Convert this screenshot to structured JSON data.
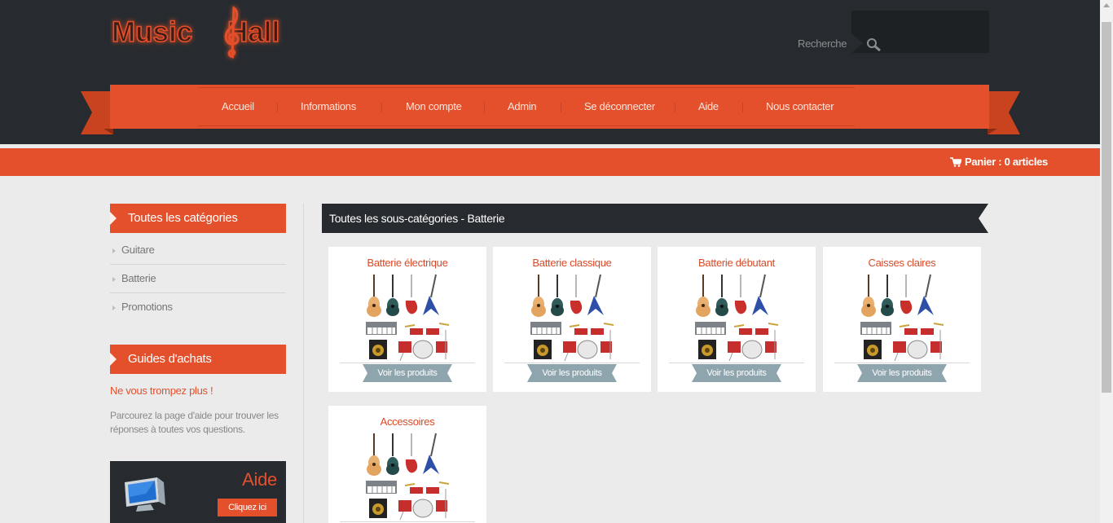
{
  "header": {
    "logo_text_left": "Music",
    "logo_text_right": "Hall",
    "search_label": "Recherche",
    "search_placeholder": ""
  },
  "nav": {
    "items": [
      {
        "label": "Accueil"
      },
      {
        "label": "Informations"
      },
      {
        "label": "Mon compte"
      },
      {
        "label": "Admin"
      },
      {
        "label": "Se déconnecter"
      },
      {
        "label": "Aide"
      },
      {
        "label": "Nous contacter"
      }
    ]
  },
  "cart": {
    "label": "Panier : 0 articles",
    "icon": "cart-icon"
  },
  "sidebar": {
    "categories_title": "Toutes les catégories",
    "categories": [
      {
        "label": "Guitare"
      },
      {
        "label": "Batterie"
      },
      {
        "label": "Promotions"
      }
    ],
    "guides_title": "Guides d'achats",
    "guide_headline": "Ne vous trompez plus !",
    "guide_text": "Parcourez la page d'aide pour trouver les réponses à toutes vos questions.",
    "aide_title": "Aide",
    "aide_button": "Cliquez ici"
  },
  "main": {
    "title": "Toutes les sous-catégories - Batterie",
    "button_label": "Voir les produits",
    "cards": [
      {
        "title": "Batterie électrique"
      },
      {
        "title": "Batterie classique"
      },
      {
        "title": "Batterie débutant"
      },
      {
        "title": "Caisses claires"
      },
      {
        "title": "Accessoires"
      }
    ]
  },
  "colors": {
    "accent": "#e4502b",
    "dark": "#272b2f",
    "background": "#ebebeb",
    "button_grey": "#8fa5ad"
  }
}
